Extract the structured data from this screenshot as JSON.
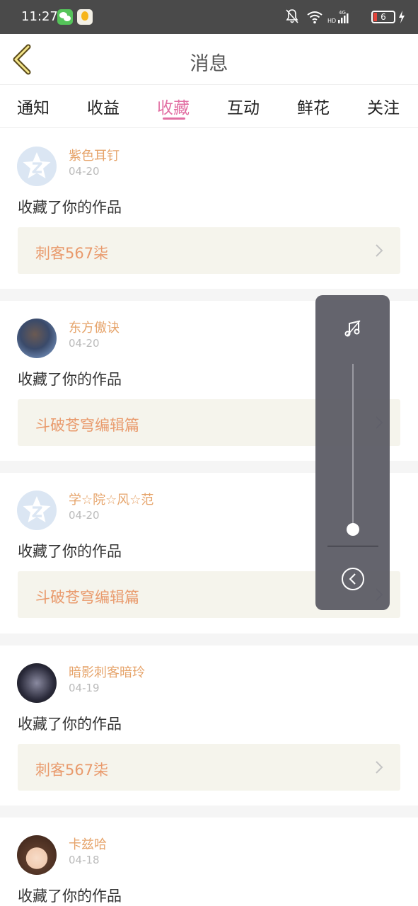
{
  "status_bar": {
    "time": "11:27",
    "battery": "6",
    "network": "4G"
  },
  "header": {
    "title": "消息"
  },
  "tabs": [
    {
      "label": "通知",
      "active": false
    },
    {
      "label": "收益",
      "active": false
    },
    {
      "label": "收藏",
      "active": true
    },
    {
      "label": "互动",
      "active": false
    },
    {
      "label": "鲜花",
      "active": false
    },
    {
      "label": "关注",
      "active": false
    }
  ],
  "messages": [
    {
      "username": "紫色耳钉",
      "date": "04-20",
      "action": "收藏了你的作品",
      "work": "刺客567柒"
    },
    {
      "username": "东方傲诀",
      "date": "04-20",
      "action": "收藏了你的作品",
      "work": "斗破苍穹编辑篇"
    },
    {
      "username": "学☆院☆风☆范",
      "date": "04-20",
      "action": "收藏了你的作品",
      "work": "斗破苍穹编辑篇"
    },
    {
      "username": "暗影刺客暗玲",
      "date": "04-19",
      "action": "收藏了你的作品",
      "work": "刺客567柒"
    },
    {
      "username": "卡兹哈",
      "date": "04-18",
      "action": "收藏了你的作品",
      "work": ""
    }
  ],
  "volume_panel": {
    "level": 0.04,
    "icon": "music-note-icon"
  },
  "colors": {
    "accent": "#e26fa3",
    "username": "#e6a46b",
    "work_title": "#e99a6c",
    "status_bar": "#4a4a4a"
  }
}
